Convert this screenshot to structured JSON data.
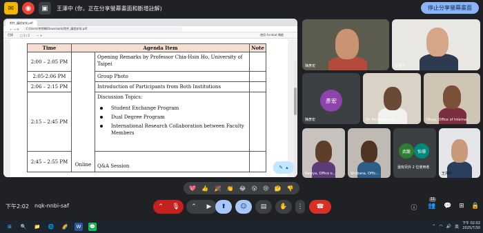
{
  "topbar": {
    "title": "王澤中 (你，正在分享螢幕畫面和斷增註解)",
    "stop_label": "停止分享螢幕畫面",
    "colors": {
      "accent": "#8ab4f8",
      "record": "#ea4335",
      "notify": "#f2b600"
    }
  },
  "browser": {
    "tab_label": "附件_議程安排.pdf",
    "url": "C:/Users/李明暉/Downloads/附件_議程安排.pdf",
    "pdf_toolbar": [
      "目錄",
      "□ 1 / 2",
      "−  +",
      "使用 Acrobat 開啟"
    ]
  },
  "agenda": {
    "headers": [
      "Time",
      "Agenda Item",
      "Note"
    ],
    "rows": [
      {
        "time": "2:00 – 2:05 PM",
        "item": "Opening Remarks by Professor Chia-Hsin Ho, University of Taipei"
      },
      {
        "time": "2:05-2:06 PM",
        "item": "Group Photo"
      },
      {
        "time": "2:06 – 2:15 PM",
        "item": "Introduction of Participants from Both Institutions"
      },
      {
        "time": "2:15 – 2:45 PM",
        "item": "Discussion Topics:",
        "bullets": [
          "Student Exchange Program",
          "Dual Degree Program",
          "International Research Collaboration between Faculty Members"
        ]
      },
      {
        "time": "2:45 – 2:55 PM",
        "item": "Q&A Session"
      }
    ],
    "mode": "Online"
  },
  "participants": [
    {
      "name": "陳彥宏",
      "type": "video"
    },
    {
      "name": "王澤中",
      "type": "video"
    },
    {
      "name": "陳彥宏",
      "type": "avatar",
      "initials": "彥宏",
      "avatar_color": "#8e44ad"
    },
    {
      "name": "Dr. Parthasarathy",
      "type": "video"
    },
    {
      "name": "Divya, Office of Internat...",
      "type": "video"
    },
    {
      "name": "Ramya, Office o...",
      "type": "video"
    },
    {
      "name": "Shobana, Offic...",
      "type": "video"
    },
    {
      "name": "還有另外 2 位使用者",
      "type": "group",
      "chips": [
        {
          "label": "武龍",
          "color": "#2e7d32"
        },
        {
          "label": "怡珊",
          "color": "#00897b"
        }
      ]
    },
    {
      "name": "王澤中",
      "type": "self"
    }
  ],
  "reactions": [
    "💖",
    "👍",
    "🎉",
    "👏",
    "😂",
    "😮",
    "😢",
    "🤔",
    "👎"
  ],
  "controls": {
    "clock": "下午2:02",
    "meeting_code": "nqk-nnbi-saf",
    "people_count": "11"
  },
  "taskbar": {
    "apps": [
      "⊞",
      "🔍",
      "📁",
      "🌐",
      "🌈",
      "W",
      "💬"
    ],
    "ime": "英",
    "time": "下午 02:02",
    "date": "2025/7/30"
  }
}
